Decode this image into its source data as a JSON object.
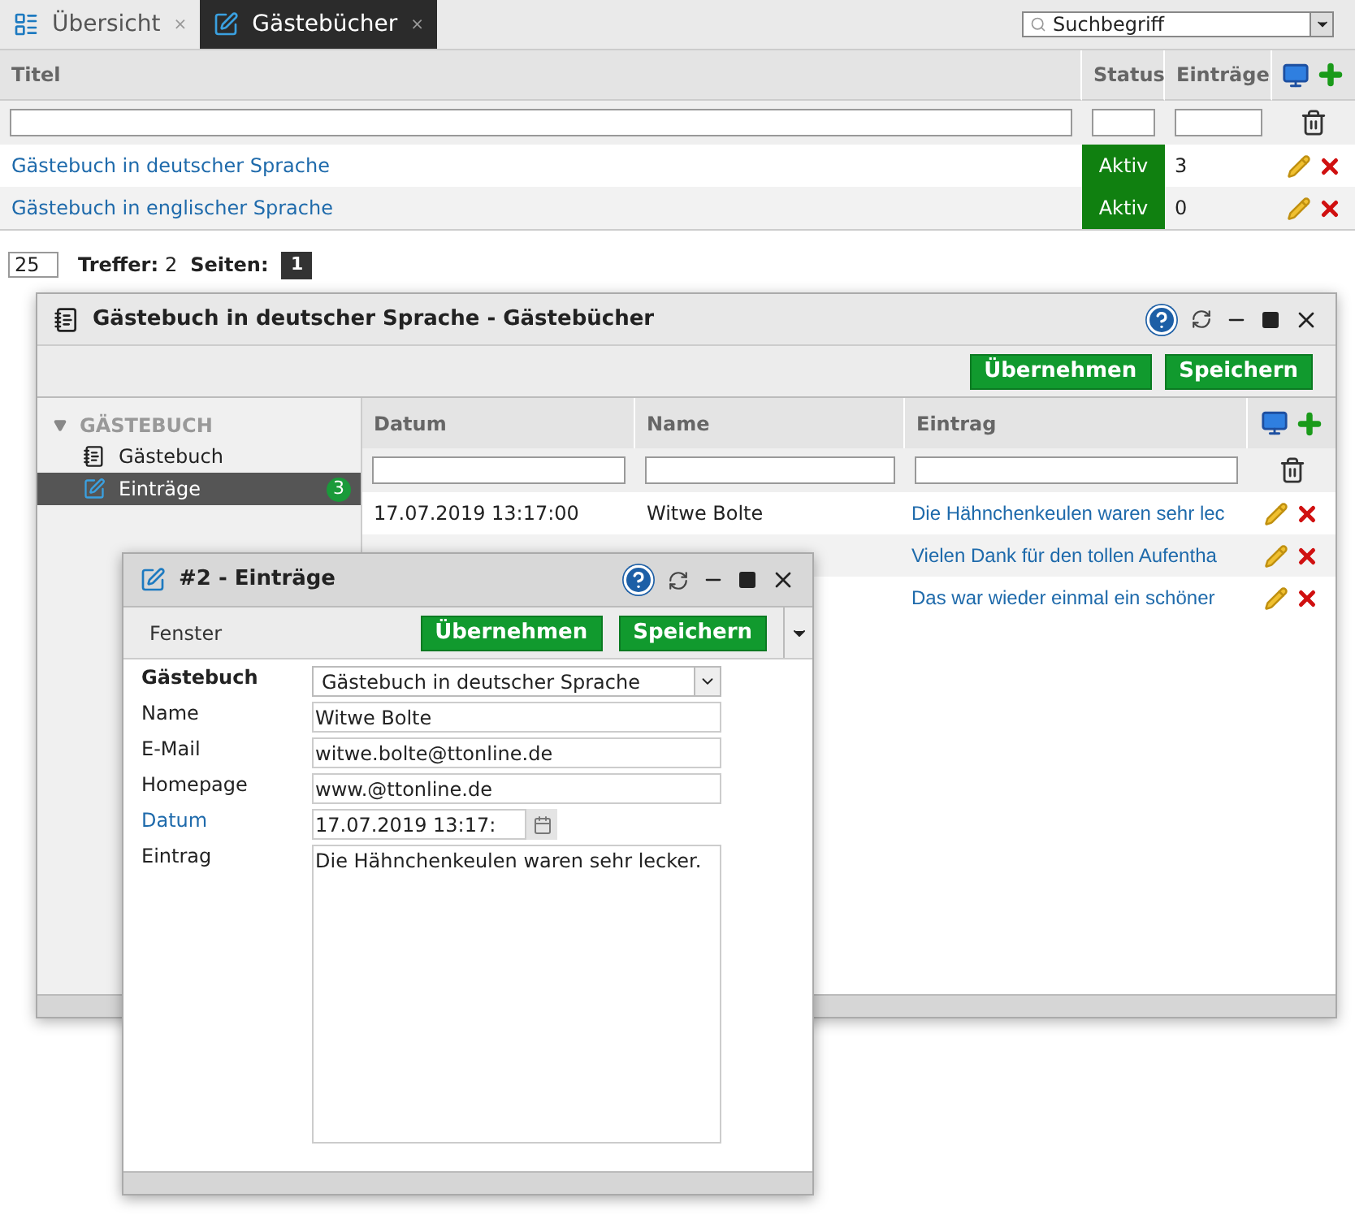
{
  "tabs": [
    {
      "label": "Übersicht",
      "selected": false,
      "close": "×"
    },
    {
      "label": "Gästebücher",
      "selected": true,
      "close": "×"
    }
  ],
  "search": {
    "placeholder": "Suchbegriff"
  },
  "table": {
    "columns": [
      "Titel",
      "Status",
      "Einträge"
    ],
    "rows": [
      {
        "title": "Gästebuch in deutscher Sprache",
        "status": "Aktiv",
        "count": "3"
      },
      {
        "title": "Gästebuch in englischer Sprache",
        "status": "Aktiv",
        "count": "0"
      }
    ]
  },
  "footer": {
    "page_size": "25",
    "hits_label": "Treffer:",
    "hits": "2",
    "pages_label": "Seiten:",
    "pages": [
      {
        "label": "1",
        "selected": true
      }
    ]
  },
  "window": {
    "title": "Gästebuch in deutscher Sprache - Gästebücher",
    "buttons": [
      "Übernehmen",
      "Speichern"
    ],
    "sidebar": {
      "group": "GÄSTEBUCH",
      "expanded": true,
      "items": [
        {
          "label": "Gästebuch",
          "selected": false,
          "kind": "book"
        },
        {
          "label": "Einträge",
          "selected": true,
          "kind": "entries",
          "badge": "3"
        }
      ]
    },
    "grid": {
      "columns": [
        "Datum",
        "Name",
        "Eintrag"
      ],
      "rows": [
        {
          "date": "17.07.2019 13:17:00",
          "name": "Witwe Bolte",
          "entry": "Die Hähnchenkeulen waren sehr lec"
        },
        {
          "entry": "Vielen Dank für den tollen Aufentha"
        },
        {
          "entry": "Das war wieder einmal ein schöner"
        }
      ]
    }
  },
  "dialog": {
    "title": "#2 - Einträge",
    "menu": "Fenster",
    "buttons": [
      "Übernehmen",
      "Speichern"
    ],
    "fields": [
      {
        "label": "Gästebuch",
        "required": true,
        "link": false,
        "kind": "select",
        "value": "Gästebuch in deutscher Sprache"
      },
      {
        "label": "Name",
        "required": false,
        "link": false,
        "kind": "text",
        "value": "Witwe Bolte"
      },
      {
        "label": "E-Mail",
        "required": false,
        "link": false,
        "kind": "text",
        "value": "witwe.bolte@ttonline.de"
      },
      {
        "label": "Homepage",
        "required": false,
        "link": false,
        "kind": "text",
        "value": "www.@ttonline.de"
      },
      {
        "label": "Datum",
        "required": false,
        "link": true,
        "kind": "date",
        "value": "17.07.2019 13:17:"
      },
      {
        "label": "Eintrag",
        "required": false,
        "link": false,
        "kind": "textarea",
        "value": "Die Hähnchenkeulen waren sehr lecker."
      }
    ]
  }
}
